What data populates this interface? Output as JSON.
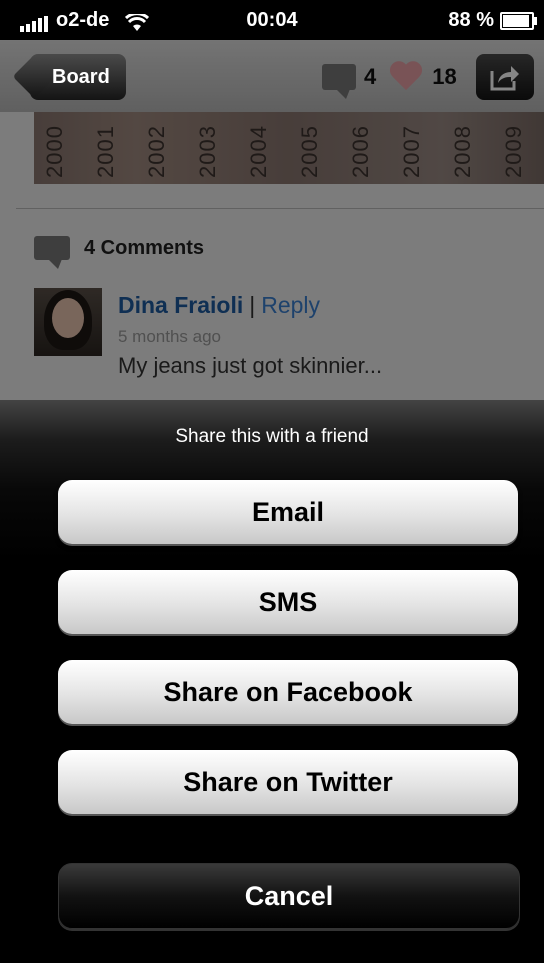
{
  "status_bar": {
    "carrier": "o2-de",
    "time": "00:04",
    "battery": "88 %",
    "icons": [
      "signal-icon",
      "wifi-icon",
      "battery-icon"
    ]
  },
  "nav_bar": {
    "back_label": "Board",
    "comment_count": "4",
    "like_count": "18",
    "icons": [
      "comment-bubble-icon",
      "heart-icon",
      "share-icon"
    ],
    "colors": {
      "heart": "#e8a0a6"
    }
  },
  "pin": {
    "years": [
      "2000",
      "2001",
      "2002",
      "2003",
      "2004",
      "2005",
      "2006",
      "2007",
      "2008",
      "2009"
    ]
  },
  "comments": {
    "heading": "4 Comments",
    "items": [
      {
        "author": "Dina Fraioli",
        "separator": "|",
        "reply_label": "Reply",
        "time": "5 months ago",
        "text": "My jeans just got skinnier..."
      }
    ]
  },
  "action_sheet": {
    "title": "Share this with a friend",
    "buttons": [
      "Email",
      "SMS",
      "Share on Facebook",
      "Share on Twitter"
    ],
    "cancel": "Cancel"
  }
}
